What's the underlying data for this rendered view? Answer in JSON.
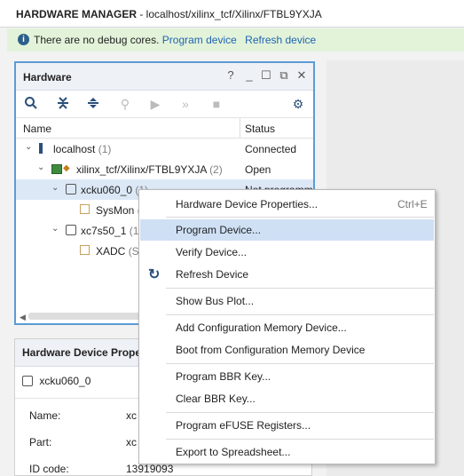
{
  "header": {
    "title_bold": "HARDWARE MANAGER",
    "title_rest": "- localhost/xilinx_tcf/Xilinx/FTBL9YXJA"
  },
  "info_bar": {
    "message": "There are no debug cores.",
    "program_link": "Program device",
    "refresh_link": "Refresh device"
  },
  "hardware_panel": {
    "title": "Hardware",
    "columns": {
      "name": "Name",
      "status": "Status"
    },
    "rows": [
      {
        "name": "localhost",
        "count": "(1)",
        "status": "Connected"
      },
      {
        "name": "xilinx_tcf/Xilinx/FTBL9YXJA",
        "count": "(2)",
        "status": "Open"
      },
      {
        "name": "xcku060_0",
        "count": "(1)",
        "status": "Not programm"
      },
      {
        "name": "SysMon",
        "count": "(",
        "status": ""
      },
      {
        "name": "xc7s50_1",
        "count": "(1",
        "status": ""
      },
      {
        "name": "XADC",
        "count": "(S",
        "status": ""
      }
    ]
  },
  "properties_panel": {
    "title": "Hardware Device Prope",
    "device": "xcku060_0",
    "fields": [
      {
        "label": "Name:",
        "value": "xc"
      },
      {
        "label": "Part:",
        "value": "xc"
      },
      {
        "label": "ID code:",
        "value": "13919093"
      }
    ]
  },
  "context_menu": {
    "items": [
      {
        "label": "Hardware Device Properties...",
        "shortcut": "Ctrl+E"
      },
      {
        "label": "Program Device..."
      },
      {
        "label": "Verify Device..."
      },
      {
        "label": "Refresh Device"
      },
      {
        "label": "Show Bus Plot..."
      },
      {
        "label": "Add Configuration Memory Device..."
      },
      {
        "label": "Boot from Configuration Memory Device"
      },
      {
        "label": "Program BBR Key..."
      },
      {
        "label": "Clear BBR Key..."
      },
      {
        "label": "Program eFUSE Registers..."
      },
      {
        "label": "Export to Spreadsheet..."
      }
    ],
    "highlighted": "Program Device..."
  },
  "colors": {
    "accent": "#5c9bd5",
    "link": "#1f64b0",
    "info_bg": "#e3f3da",
    "highlight": "#cfe0f5"
  }
}
